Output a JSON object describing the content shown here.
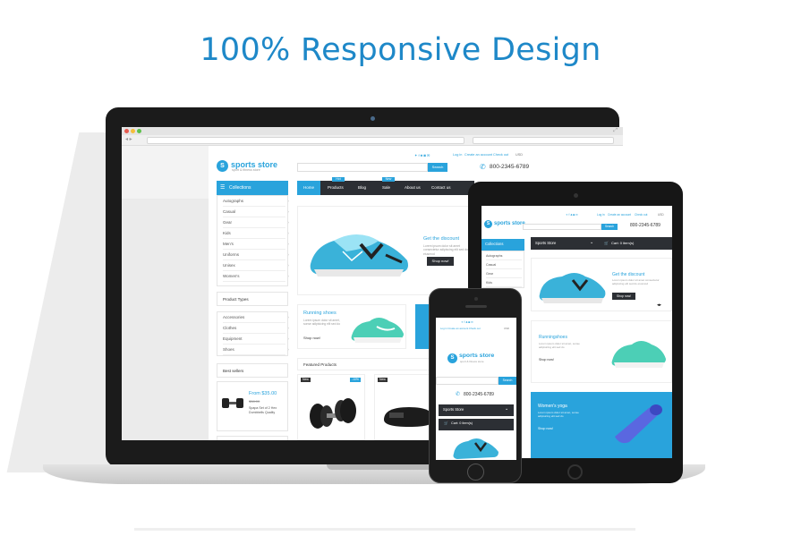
{
  "headline": "100% Responsive Design",
  "colors": {
    "accent": "#29a3dc",
    "headline": "#1e88c8",
    "nav_dark": "#2c2f34",
    "device": "#1b1b1b"
  },
  "site": {
    "logo_letter": "S",
    "name": "sports store",
    "tagline": "sport & fitness store",
    "phone": "800-2345-6789",
    "top_links": [
      "Log in",
      "Create an account",
      "Check out",
      "USD"
    ],
    "search_btn": "Search",
    "collections": "Collections",
    "collection_items": [
      "Autographs",
      "Casual",
      "Gear",
      "Kids",
      "Men's",
      "Uniforms",
      "Unisex",
      "Women's"
    ],
    "product_types": "Product Types",
    "type_items": [
      "Accessories",
      "Clothes",
      "Equipment",
      "Shoes"
    ],
    "best_sellers": "Best sellers",
    "best_price_from": "From $35.00",
    "best_old_price": "$38.00",
    "best_product": "Spapa Set of 2 Hex Dumbbells Quality",
    "nav": [
      "Home",
      "Products",
      "Blog",
      "Sale",
      "About us",
      "Contact us"
    ],
    "nav_badges": [
      "Hot",
      "New"
    ],
    "discount_title": "Get the discount",
    "discount_text": "Lorem ipsum dolor sit amet consectetur adipiscing elit sed do eiusmod",
    "shop_now": "Shop now!",
    "running": "Running shoes",
    "running_text": "Lorem ipsum dolor sit amet, sonse adipisicing elit sed do",
    "shop_now_small": "Shop now!",
    "featured": "Featured Products",
    "badge_new": "New",
    "badge_sale": "-10%"
  },
  "tablet": {
    "store_btn": "Sports Store",
    "cart": "Cart: 0 item(s)",
    "discount": "Get the discount",
    "running": "Runningshoes",
    "yoga": "Women's yoga",
    "shop": "Shop now!"
  },
  "phone": {
    "links": "Log in  Create an account  Check out",
    "usd": "USD",
    "name": "sports store",
    "tagline": "sport & fitness store",
    "search": "Search",
    "phone": "800-2345-6789",
    "menu": "Sports Store",
    "cart": "Cart: 0 item(s)"
  }
}
